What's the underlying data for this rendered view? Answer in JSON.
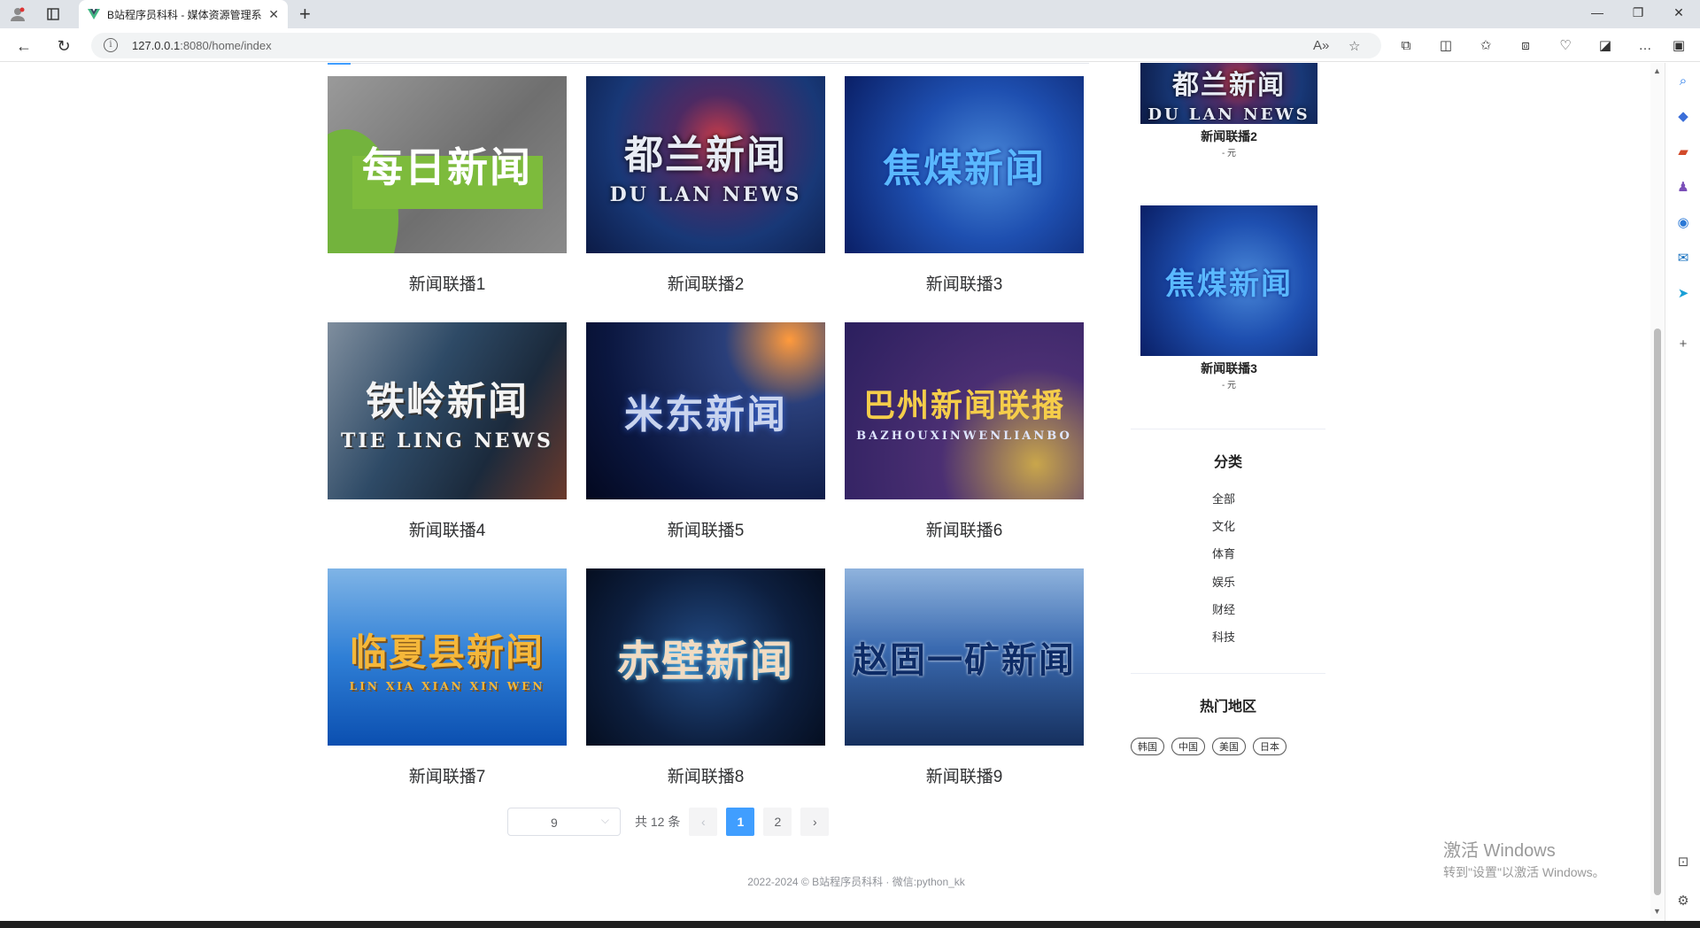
{
  "browser": {
    "tab_title": "B站程序员科科 - 媒体资源管理系",
    "url_host": "127.0.0.1",
    "url_rest": ":8080/home/index"
  },
  "news": [
    {
      "title": "新闻联播1",
      "thumb_text": "每日新闻",
      "thumb_sub": ""
    },
    {
      "title": "新闻联播2",
      "thumb_text": "都兰新闻",
      "thumb_sub": "DU LAN NEWS"
    },
    {
      "title": "新闻联播3",
      "thumb_text": "焦煤新闻",
      "thumb_sub": ""
    },
    {
      "title": "新闻联播4",
      "thumb_text": "铁岭新闻",
      "thumb_sub": "TIE LING NEWS"
    },
    {
      "title": "新闻联播5",
      "thumb_text": "米东新闻",
      "thumb_sub": ""
    },
    {
      "title": "新闻联播6",
      "thumb_text": "巴州新闻联播",
      "thumb_sub": "BAZHOUXINWENLIANBO"
    },
    {
      "title": "新闻联播7",
      "thumb_text": "临夏县新闻",
      "thumb_sub": "LIN XIA XIAN XIN WEN"
    },
    {
      "title": "新闻联播8",
      "thumb_text": "赤壁新闻",
      "thumb_sub": ""
    },
    {
      "title": "新闻联播9",
      "thumb_text": "赵固一矿新闻",
      "thumb_sub": ""
    }
  ],
  "pagination": {
    "page_size": "9",
    "total_text": "共 12 条",
    "prev": "‹",
    "next": "›",
    "pages": [
      "1",
      "2"
    ],
    "current": "1"
  },
  "footer": "2022-2024 © B站程序员科科 · 微信:python_kk",
  "sidebar": {
    "recommend": [
      {
        "name": "新闻联播2",
        "price": "- 元",
        "thumb_text": "都兰新闻",
        "thumb_sub": "DU LAN NEWS"
      },
      {
        "name": "新闻联播3",
        "price": "- 元",
        "thumb_text": "焦煤新闻",
        "thumb_sub": ""
      }
    ],
    "category_heading": "分类",
    "categories": [
      "全部",
      "文化",
      "体育",
      "娱乐",
      "财经",
      "科技"
    ],
    "region_heading": "热门地区",
    "regions": [
      "韩国",
      "中国",
      "美国",
      "日本"
    ]
  },
  "watermark": {
    "line1": "激活 Windows",
    "line2": "转到\"设置\"以激活 Windows。"
  }
}
